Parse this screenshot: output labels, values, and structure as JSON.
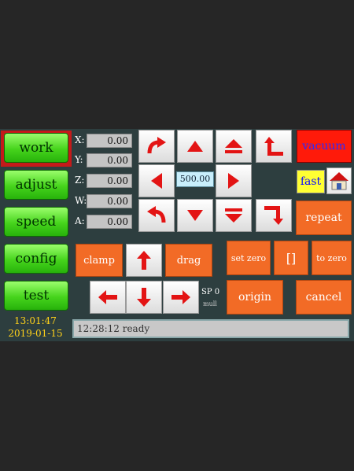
{
  "sidebar": {
    "items": [
      {
        "label": "work",
        "selected": true
      },
      {
        "label": "adjust"
      },
      {
        "label": "speed"
      },
      {
        "label": "config"
      },
      {
        "label": "test"
      }
    ],
    "time": "13:01:47",
    "date": "2019-01-15"
  },
  "axes": [
    {
      "label": "X:",
      "value": "0.00"
    },
    {
      "label": "Y:",
      "value": "0.00"
    },
    {
      "label": "Z:",
      "value": "0.00"
    },
    {
      "label": "W:",
      "value": "0.00"
    },
    {
      "label": "A:",
      "value": "0.00"
    }
  ],
  "jog": {
    "speed_value": "500.00"
  },
  "buttons": {
    "vacuum": "vacuum",
    "fast": "fast",
    "repeat": "repeat",
    "clamp": "clamp",
    "drag": "drag",
    "set_zero": "set zero",
    "bracket": "[]",
    "to_zero": "to zero",
    "origin": "origin",
    "cancel": "cancel"
  },
  "sp_label": "SP 0",
  "mull_label": "mull",
  "status": "12:28:12 ready",
  "colors": {
    "screen_bg": "#2d3e3f",
    "green_button": "#46d41c",
    "orange_button": "#f26b26",
    "arrow_red": "#e31414",
    "clock_yellow": "#ffd21a"
  }
}
